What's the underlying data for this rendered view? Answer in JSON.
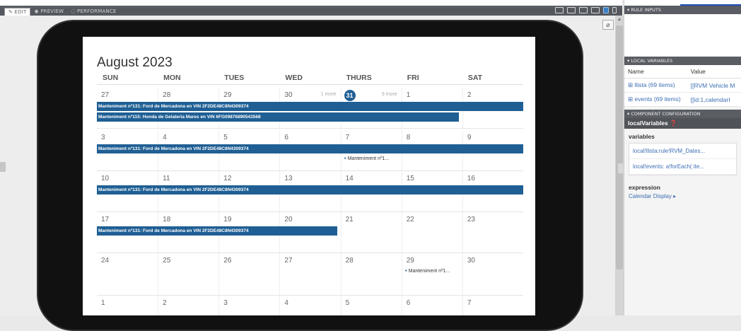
{
  "toolbar": {
    "tabs": [
      "EDIT",
      "PREVIEW",
      "PERFORMANCE"
    ],
    "tab_icons": [
      "pencil-icon",
      "eye-icon",
      "gauge-icon"
    ]
  },
  "calendar": {
    "title": "August 2023",
    "weekdays": [
      "SUN",
      "MON",
      "TUES",
      "WED",
      "THURS",
      "FRI",
      "SAT"
    ],
    "accent": "#1f5f94",
    "weeks": [
      {
        "days": [
          "27",
          "28",
          "29",
          "30",
          "31",
          "1",
          "2"
        ],
        "today_index": 4,
        "more": [
          {
            "day": 3,
            "label": "1 more"
          },
          {
            "day": 4,
            "label": "9 more"
          }
        ],
        "bars": [
          {
            "label": "Manteniment nº131: Ford de Mercadona en VIN 2F2DE48C8N4309374",
            "start": 0,
            "span": 7,
            "row": 0
          },
          {
            "label": "Manteniment nº115: Honda de Gelateria Mares en VIN 6FG09876890543568",
            "start": 0,
            "span": 6,
            "row": 1
          }
        ],
        "dots": []
      },
      {
        "days": [
          "3",
          "4",
          "5",
          "6",
          "7",
          "8",
          "9"
        ],
        "today_index": -1,
        "more": [],
        "bars": [
          {
            "label": "Manteniment nº131: Ford de Mercadona en VIN 2F2DE48C8N4309374",
            "start": 0,
            "span": 7,
            "row": 0
          }
        ],
        "dots": [
          {
            "label": "Manteniment nº1...",
            "day": 4,
            "row": 1
          }
        ]
      },
      {
        "days": [
          "10",
          "11",
          "12",
          "13",
          "14",
          "15",
          "16"
        ],
        "today_index": -1,
        "more": [],
        "bars": [
          {
            "label": "Manteniment nº131: Ford de Mercadona en VIN 2F2DE48C8N4309374",
            "start": 0,
            "span": 7,
            "row": 0
          }
        ],
        "dots": []
      },
      {
        "days": [
          "17",
          "18",
          "19",
          "20",
          "21",
          "22",
          "23"
        ],
        "today_index": -1,
        "more": [],
        "bars": [
          {
            "label": "Manteniment nº131: Ford de Mercadona en VIN 2F2DE48C8N4309374",
            "start": 0,
            "span": 4,
            "row": 0
          }
        ],
        "dots": []
      },
      {
        "days": [
          "24",
          "25",
          "26",
          "27",
          "28",
          "29",
          "30"
        ],
        "today_index": -1,
        "more": [],
        "bars": [],
        "dots": [
          {
            "label": "Manteniment nº1...",
            "day": 5,
            "row": 0
          }
        ]
      },
      {
        "days": [
          "1",
          "2",
          "3",
          "4",
          "5",
          "6",
          "7"
        ],
        "today_index": -1,
        "more": [],
        "bars": [],
        "dots": []
      }
    ]
  },
  "panel": {
    "rule_inputs": "RULE INPUTS",
    "local_variables": "LOCAL VARIABLES",
    "col_name": "Name",
    "col_value": "Value",
    "rows": [
      {
        "name": "llista (69 items)",
        "value": "[[RVM Vehicle M"
      },
      {
        "name": "events (69 items)",
        "value": "[[id:1,calendarI"
      }
    ],
    "component_config": "COMPONENT CONFIGURATION",
    "component_name": "localVariables",
    "variables_label": "variables",
    "variables": [
      "local!llista:rule!RVM_Dates...",
      "local!events: a!forEach( ite..."
    ],
    "expression_label": "expression",
    "expression_value": "Calendar Display ▸"
  }
}
